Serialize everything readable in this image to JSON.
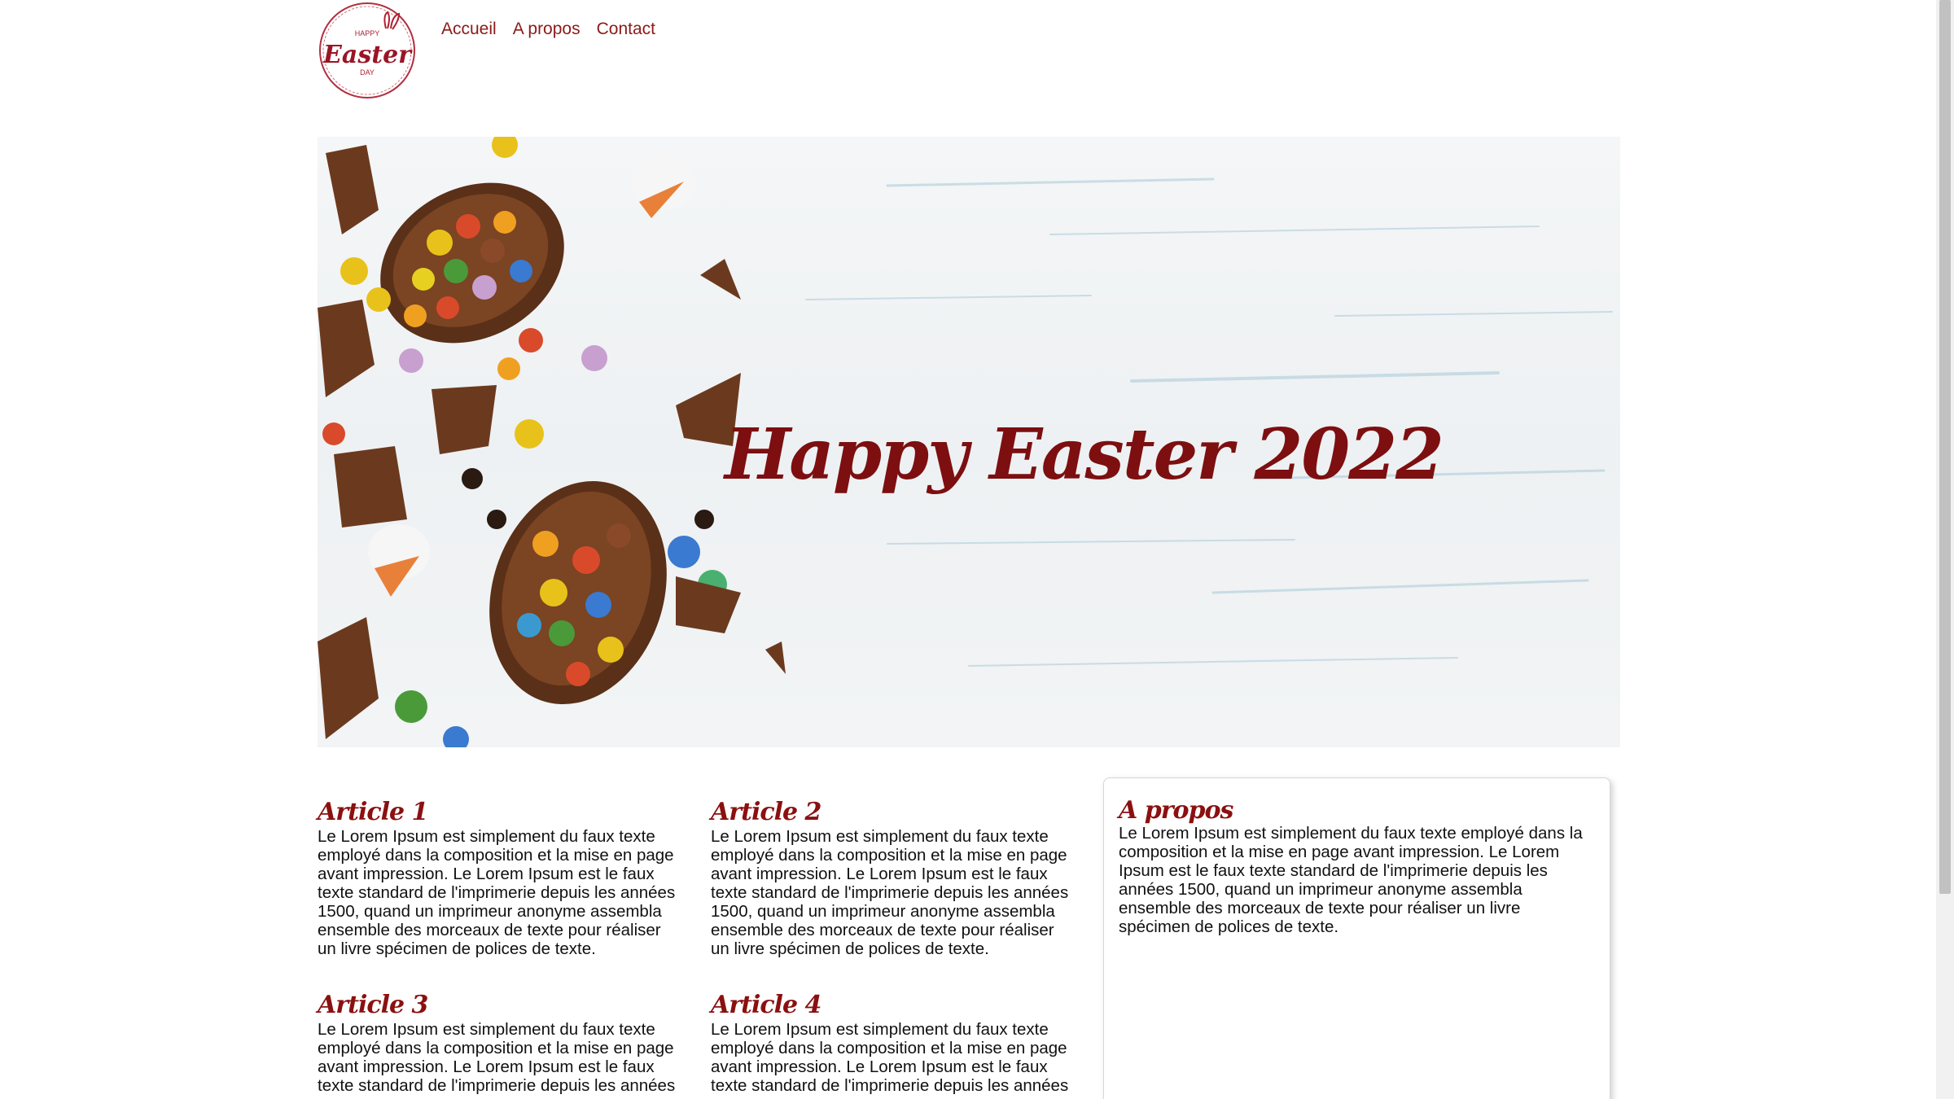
{
  "logo": {
    "line1": "HAPPY",
    "line2": "Easter",
    "line3": "DAY"
  },
  "nav": {
    "items": [
      {
        "label": "Accueil"
      },
      {
        "label": "A propos"
      },
      {
        "label": "Contact"
      }
    ]
  },
  "hero": {
    "title": "Happy Easter 2022"
  },
  "articles": [
    {
      "title": "Article 1",
      "text": "Le Lorem Ipsum est simplement du faux texte employé dans la composition et la mise en page avant impression. Le Lorem Ipsum est le faux texte standard de l'imprimerie depuis les années 1500, quand un imprimeur anonyme assembla ensemble des morceaux de texte pour réaliser un livre spécimen de polices de texte."
    },
    {
      "title": "Article 2",
      "text": "Le Lorem Ipsum est simplement du faux texte employé dans la composition et la mise en page avant impression. Le Lorem Ipsum est le faux texte standard de l'imprimerie depuis les années 1500, quand un imprimeur anonyme assembla ensemble des morceaux de texte pour réaliser un livre spécimen de polices de texte."
    },
    {
      "title": "Article 3",
      "text": "Le Lorem Ipsum est simplement du faux texte employé dans la composition et la mise en page avant impression. Le Lorem Ipsum est le faux texte standard de l'imprimerie depuis les années"
    },
    {
      "title": "Article 4",
      "text": "Le Lorem Ipsum est simplement du faux texte employé dans la composition et la mise en page avant impression. Le Lorem Ipsum est le faux texte standard de l'imprimerie depuis les années"
    }
  ],
  "sidebar": {
    "title": "A propos",
    "text": "Le Lorem Ipsum est simplement du faux texte employé dans la composition et la mise en page avant impression. Le Lorem Ipsum est le faux texte standard de l'imprimerie depuis les années 1500, quand un imprimeur anonyme assembla ensemble des morceaux de texte pour réaliser un livre spécimen de polices de texte."
  },
  "colors": {
    "accent": "#8b1010",
    "nav_link": "#8b1a1a"
  }
}
